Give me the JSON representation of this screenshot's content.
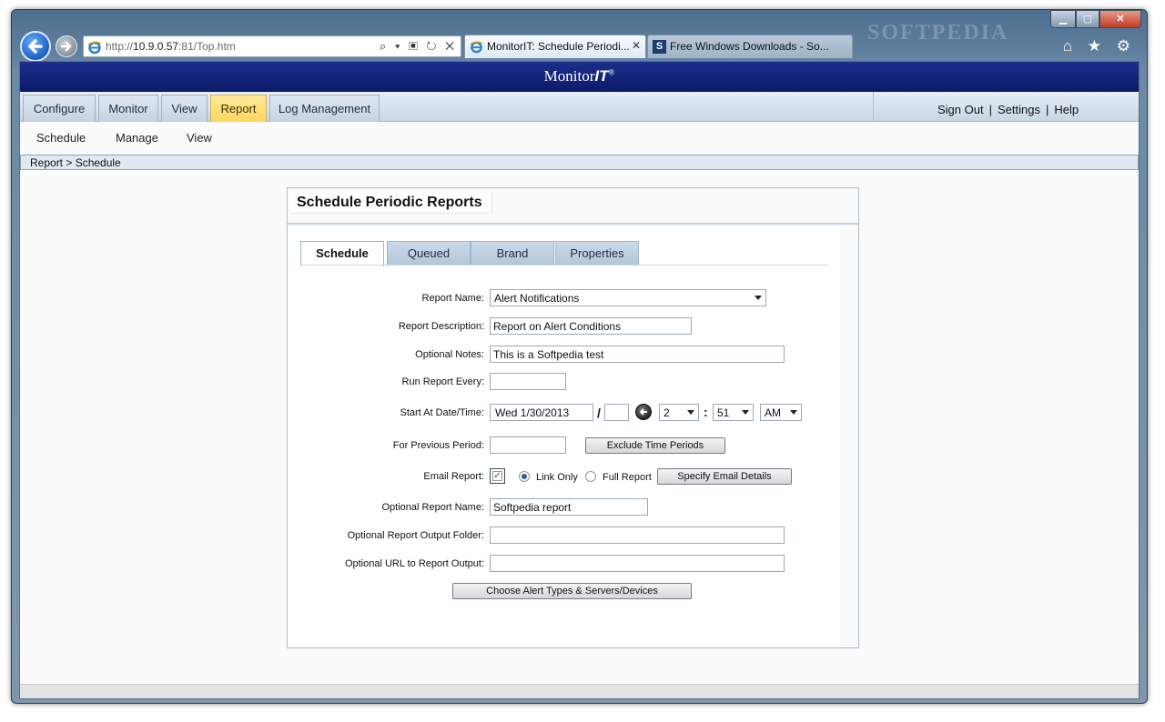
{
  "browser": {
    "url_prefix": "http://",
    "url_host": "10.9.0.57",
    "url_rest": ":81/Top.htm",
    "address_tools": "⌕ ▾ ▣ ↻ ✕",
    "tabs": [
      {
        "title": "MonitorIT: Schedule Periodi...",
        "icon": "ie-icon",
        "close": "✕"
      },
      {
        "title": "Free Windows Downloads - So...",
        "icon": "softpedia-icon",
        "badge": "S"
      }
    ],
    "window_controls": {
      "minimize": "▁",
      "maximize": "▢",
      "close": "✕"
    },
    "toolbar_icons": "⌂ ★ ⚙",
    "watermark": "SOFTPEDIA"
  },
  "app": {
    "brand_text": "Monitor",
    "brand_it": "IT",
    "brand_reg": "®",
    "main_tabs": [
      {
        "label": "Configure",
        "active": false
      },
      {
        "label": "Monitor",
        "active": false
      },
      {
        "label": "View",
        "active": false
      },
      {
        "label": "Report",
        "active": true
      },
      {
        "label": "Log Management",
        "active": false
      }
    ],
    "right_links": [
      "Sign Out",
      "Settings",
      "Help"
    ],
    "link_separator": "|",
    "sub_nav": [
      "Schedule",
      "Manage",
      "View"
    ],
    "breadcrumb": "Report > Schedule"
  },
  "panel": {
    "title": "Schedule Periodic Reports",
    "inner_tabs": [
      {
        "label": "Schedule",
        "active": true
      },
      {
        "label": "Queued",
        "active": false
      },
      {
        "label": "Brand",
        "active": false
      },
      {
        "label": "Properties",
        "active": false
      }
    ],
    "form": {
      "report_name_label": "Report Name:",
      "report_name_value": "Alert Notifications",
      "report_description_label": "Report Description:",
      "report_description_value": "Report on Alert Conditions",
      "optional_notes_label": "Optional Notes:",
      "optional_notes_value": "This is a Softpedia test",
      "run_report_every_label": "Run Report Every:",
      "run_report_every_value": "",
      "start_label": "Start At Date/Time:",
      "start_date": "Wed  1/30/2013",
      "date_separator": "/",
      "start_extra": "",
      "hour": "2",
      "time_separator": ":",
      "minute": "51",
      "ampm": "AM",
      "previous_period_label": "For Previous Period:",
      "previous_period_value": "",
      "exclude_button": "Exclude Time Periods",
      "email_report_label": "Email Report:",
      "email_checked": true,
      "email_check_mark": "✓",
      "link_only_label": "Link Only",
      "full_report_label": "Full Report",
      "email_mode": "Link Only",
      "specify_email_button": "Specify Email Details",
      "optional_report_name_label": "Optional Report Name:",
      "optional_report_name_value": "Softpedia report",
      "output_folder_label": "Optional Report Output Folder:",
      "output_folder_value": "",
      "url_output_label": "Optional URL to Report Output:",
      "url_output_value": "",
      "choose_button": "Choose Alert Types & Servers/Devices"
    }
  },
  "colors": {
    "banner": "#0c1a6b",
    "active_tab": "#ffd75a",
    "tab_blue": "#b3c7db",
    "panel_border": "#a8c0d8"
  }
}
